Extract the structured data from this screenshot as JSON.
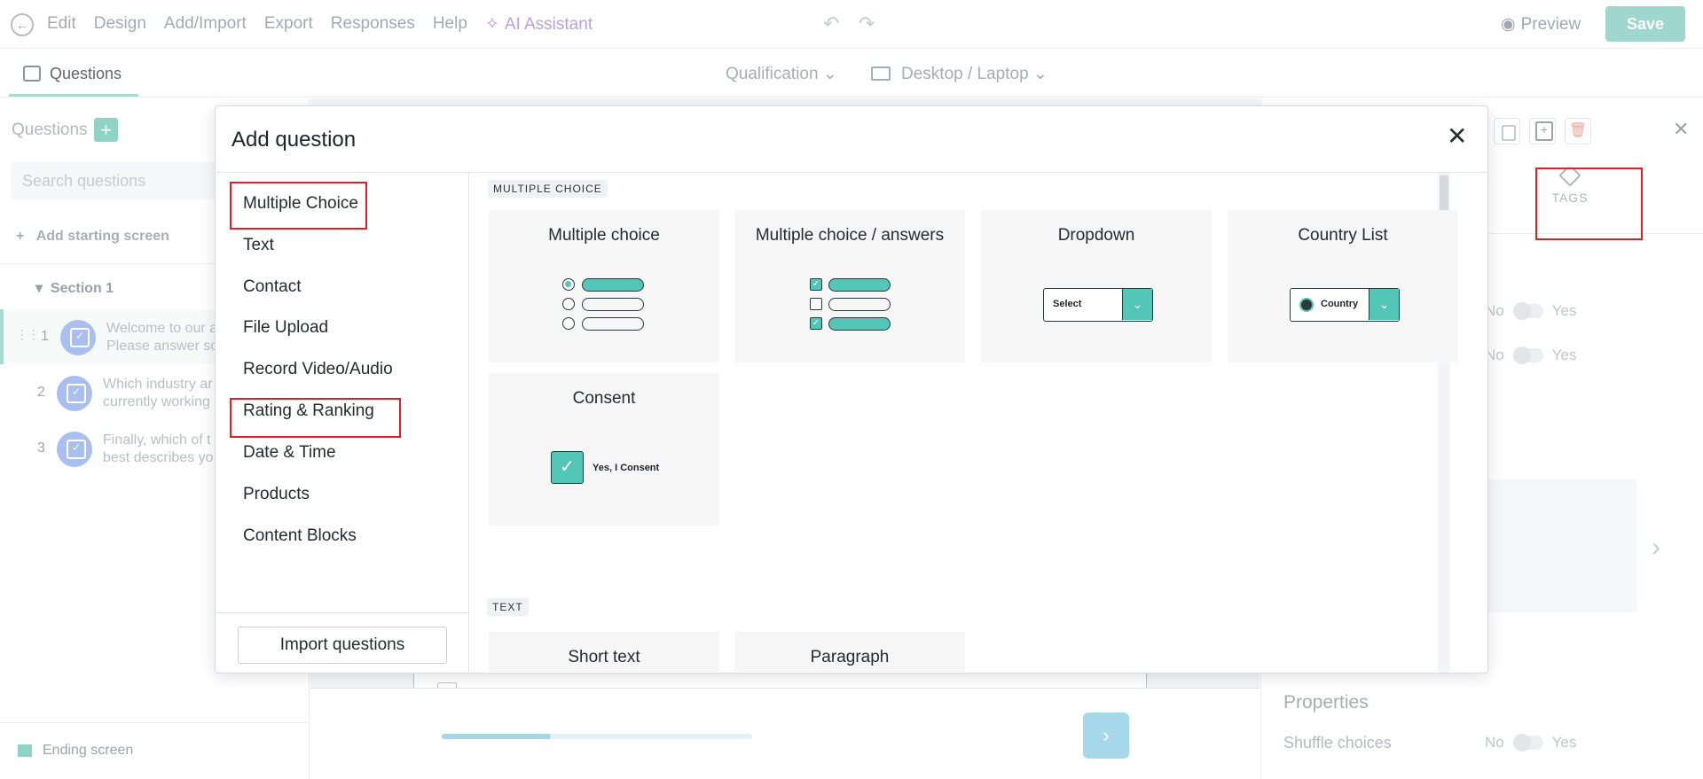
{
  "topbar": {
    "menu": [
      "Edit",
      "Design",
      "Add/Import",
      "Export",
      "Responses",
      "Help"
    ],
    "ai_assistant": "AI Assistant",
    "preview": "Preview",
    "save": "Save"
  },
  "subbar": {
    "tab": "Questions",
    "qualification": "Qualification",
    "device": "Desktop / Laptop"
  },
  "sidebar": {
    "title": "Questions",
    "search_placeholder": "Search questions",
    "add_starting_screen": "Add starting screen",
    "section": "Section 1",
    "questions": [
      {
        "num": "1",
        "line1": "Welcome to our a",
        "line2": "Please answer sor"
      },
      {
        "num": "2",
        "line1": "Which industry ar",
        "line2": "currently working"
      },
      {
        "num": "3",
        "line1": "Finally, which of t",
        "line2": "best describes yo"
      }
    ],
    "ending_screen": "Ending screen"
  },
  "center": {
    "progress_fraction": 0.35
  },
  "right_panel": {
    "tags_label": "TAGS",
    "no": "No",
    "yes": "Yes",
    "properties": "Properties",
    "shuffle_choices": "Shuffle choices"
  },
  "modal": {
    "title": "Add question",
    "nav": [
      "Multiple Choice",
      "Text",
      "Contact",
      "File Upload",
      "Record Video/Audio",
      "Rating & Ranking",
      "Date & Time",
      "Products",
      "Content Blocks"
    ],
    "import_button": "Import questions",
    "sections": [
      {
        "label": "MULTIPLE CHOICE",
        "cards": [
          "Multiple choice",
          "Multiple choice / answers",
          "Dropdown",
          "Country List",
          "Consent"
        ]
      },
      {
        "label": "TEXT",
        "cards": [
          "Short text",
          "Paragraph"
        ]
      }
    ],
    "illustrations": {
      "dropdown_text": "Select",
      "country_text": "Country",
      "consent_text": "Yes, I Consent"
    }
  },
  "colors": {
    "accent": "#53c6b7",
    "highlight": "#e01f28",
    "save_button": "#9fd6cd"
  }
}
